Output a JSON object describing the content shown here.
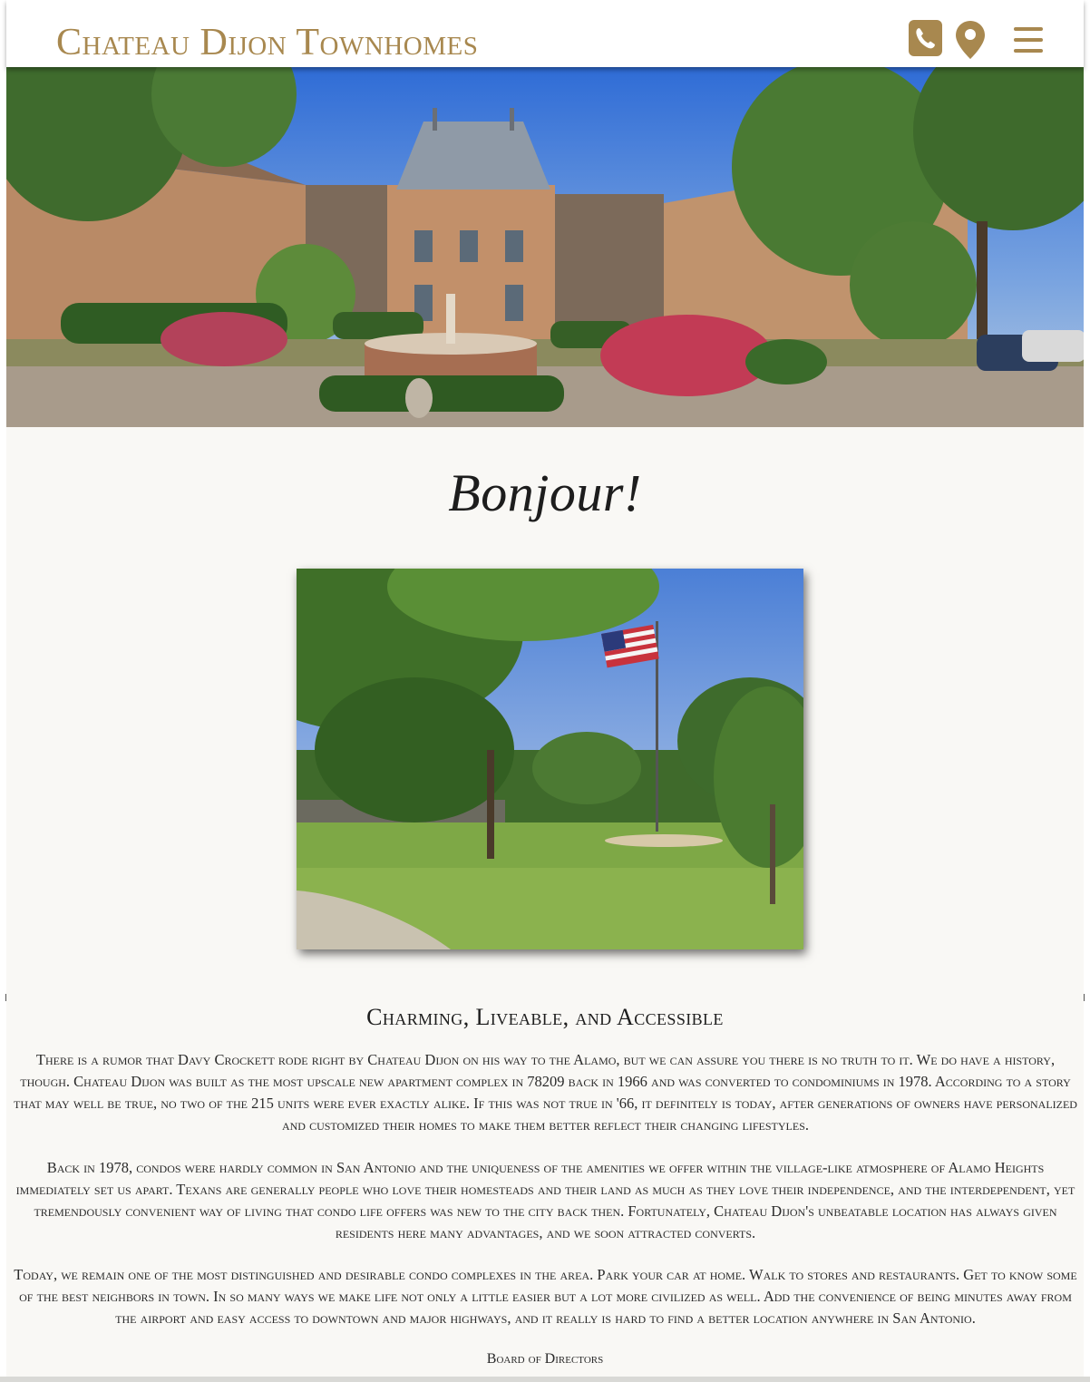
{
  "header": {
    "brand": "Chateau Dijon Townhomes",
    "icons": [
      "phone-icon",
      "map-pin-icon",
      "hamburger-menu-icon"
    ],
    "accent_color": "#a8884f"
  },
  "hero": {
    "image": "courtyard-panorama"
  },
  "greeting": "Bonjour!",
  "photo": {
    "image": "flag-lawn-photo"
  },
  "section": {
    "title": "Charming, Liveable, and Accessible",
    "paragraphs": [
      "There is a rumor that Davy Crockett rode right by Chateau Dijon on his way to the Alamo, but we can assure you there is no truth to it. We do have a history, though. Chateau Dijon was built as the most upscale new apartment complex in 78209 back in 1966 and was converted to condominiums in 1978. According to a story that may well be true, no two of the 215 units were ever exactly alike. If this was not true in '66, it definitely is today, after generations of owners have personalized and customized their homes to make them better reflect their changing lifestyles.",
      "Back in 1978, condos were hardly common in San Antonio and the uniqueness of the amenities we offer within the village-like atmosphere of Alamo Heights immediately set us apart. Texans are generally people who love their homesteads and their land as much as they love their independence, and the interdependent, yet tremendously convenient way of living that condo life offers was new to the city back then. Fortunately, Chateau Dijon's unbeatable location has always given residents here many advantages, and we soon attracted converts.",
      "Today, we remain one of the most distinguished and desirable condo complexes in the area. Park your car at home. Walk to stores and restaurants. Get to know some of the best neighbors in town. In so many ways we make life not only a little easier but a lot more civilized as well. Add the convenience of being minutes away from the airport and easy access to downtown and major highways, and it really is hard to find a better location anywhere in San Antonio."
    ],
    "signoff": "Board of Directors"
  }
}
